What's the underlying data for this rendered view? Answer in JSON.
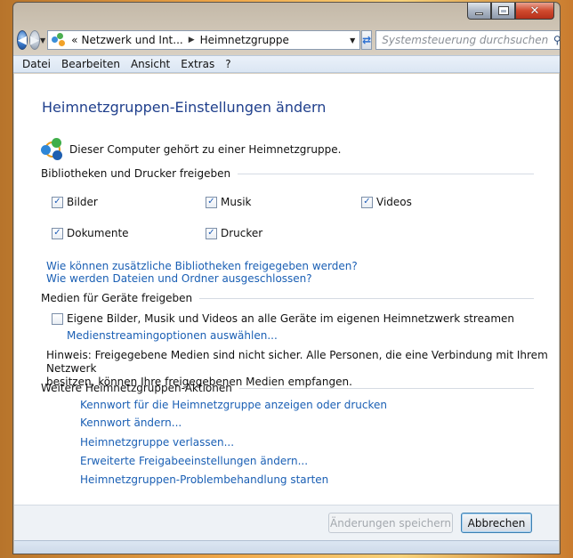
{
  "window": {
    "close_glyph": "✕"
  },
  "address_bar": {
    "nav_chevron": "«",
    "crumbs": [
      "Netzwerk und Int...",
      "Heimnetzgruppe"
    ],
    "search_placeholder": "Systemsteuerung durchsuchen"
  },
  "menu": [
    "Datei",
    "Bearbeiten",
    "Ansicht",
    "Extras",
    "?"
  ],
  "page": {
    "title": "Heimnetzgruppen-Einstellungen ändern",
    "homegroup_status": "Dieser Computer gehört zu einer Heimnetzgruppe."
  },
  "libraries": {
    "heading": "Bibliotheken und Drucker freigeben",
    "items": [
      {
        "label": "Bilder",
        "checked": true
      },
      {
        "label": "Musik",
        "checked": true
      },
      {
        "label": "Videos",
        "checked": true
      },
      {
        "label": "Dokumente",
        "checked": true
      },
      {
        "label": "Drucker",
        "checked": true
      }
    ],
    "link_more_libraries": "Wie können zusätzliche Bibliotheken freigegeben werden?",
    "link_excluded": "Wie werden Dateien und Ordner ausgeschlossen?"
  },
  "media": {
    "heading": "Medien für Geräte freigeben",
    "stream_label": "Eigene Bilder, Musik und Videos an alle Geräte im eigenen Heimnetzwerk streamen",
    "stream_checked": false,
    "options_link": "Medienstreamingoptionen auswählen...",
    "note_line1": "Hinweis: Freigegebene Medien sind nicht sicher. Alle Personen, die eine Verbindung mit Ihrem Netzwerk",
    "note_line2": "besitzen, können Ihre freigegebenen Medien empfangen."
  },
  "actions": {
    "heading": "Weitere Heimnetzgruppen-Aktionen",
    "links": [
      "Kennwort für die Heimnetzgruppe anzeigen oder drucken",
      "Kennwort ändern...",
      "Heimnetzgruppe verlassen...",
      "Erweiterte Freigabeeinstellungen ändern...",
      "Heimnetzgruppen-Problembehandlung starten"
    ]
  },
  "buttons": {
    "save": "Änderungen speichern",
    "cancel": "Abbrechen"
  },
  "colors": {
    "link": "#1a5fb4",
    "title": "#1f3f8c"
  }
}
